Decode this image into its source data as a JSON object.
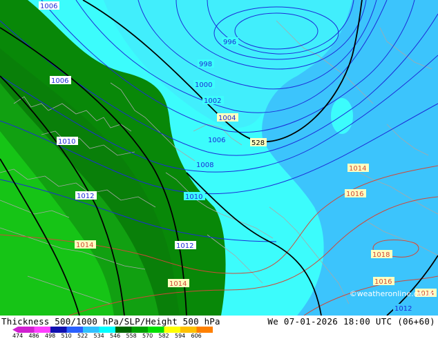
{
  "map": {
    "isobar_labels": [
      "1006",
      "996",
      "998",
      "1000",
      "1002",
      "1004",
      "1006",
      "1008",
      "1010",
      "1006",
      "1010",
      "1008",
      "1012",
      "1010",
      "1012",
      "1014",
      "1014",
      "1014",
      "1016",
      "1018",
      "1016",
      "1014",
      "1012",
      "528"
    ],
    "credit": "©weatheronline.co.uk"
  },
  "footer": {
    "title": "Thickness 500/1000 hPa/SLP/Height 500 hPa",
    "valid": "We 07-01-2026 18:00 UTC (06+60)",
    "legend": {
      "ticks": [
        "474",
        "486",
        "498",
        "510",
        "522",
        "534",
        "546",
        "558",
        "570",
        "582",
        "594",
        "606"
      ],
      "colors": [
        "#d020d0",
        "#ff40ff",
        "#1010b0",
        "#2a60ff",
        "#30c0ff",
        "#00ffff",
        "#006400",
        "#00a000",
        "#00e000",
        "#ffff00",
        "#ffc000",
        "#ff8000"
      ]
    }
  }
}
